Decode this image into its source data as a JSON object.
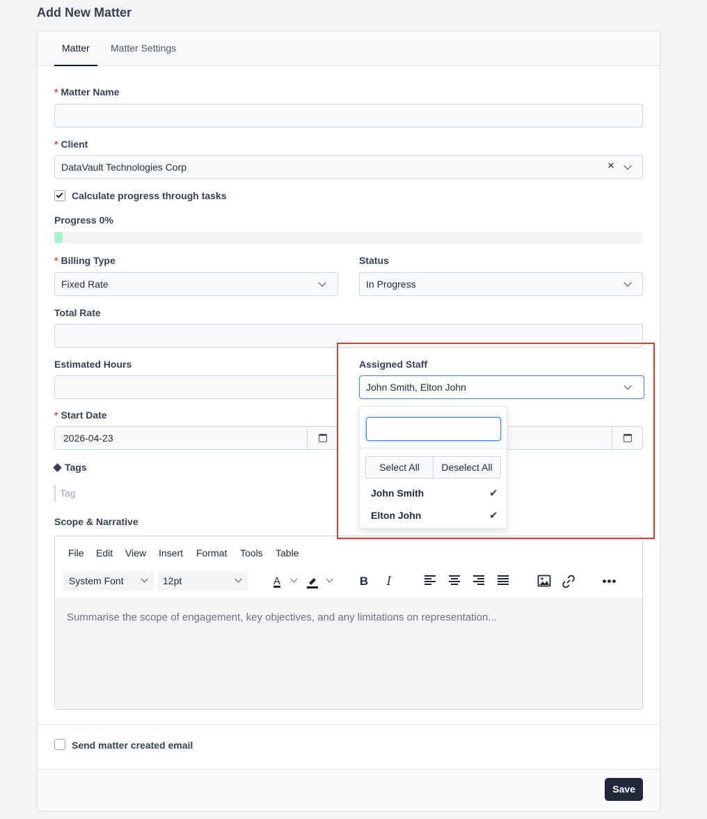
{
  "page": {
    "title": "Add New Matter"
  },
  "tabs": [
    {
      "label": "Matter"
    },
    {
      "label": "Matter Settings"
    }
  ],
  "form": {
    "required_marker": "*",
    "matter_name": {
      "label": "Matter Name",
      "value": ""
    },
    "client": {
      "label": "Client",
      "value": "DataVault Technologies Corp"
    },
    "calculate_progress": {
      "label": "Calculate progress through tasks",
      "checked": true
    },
    "progress": {
      "label": "Progress 0%",
      "value": 0
    },
    "billing_type": {
      "label": "Billing Type",
      "value": "Fixed Rate"
    },
    "status": {
      "label": "Status",
      "value": "In Progress"
    },
    "total_rate": {
      "label": "Total Rate",
      "value": ""
    },
    "estimated_hours": {
      "label": "Estimated Hours",
      "value": ""
    },
    "assigned_staff": {
      "label": "Assigned Staff",
      "value": "John Smith, Elton John",
      "search_value": "",
      "select_all": "Select All",
      "deselect_all": "Deselect All",
      "options": [
        {
          "label": "John Smith",
          "selected": true
        },
        {
          "label": "Elton John",
          "selected": true
        }
      ]
    },
    "start_date": {
      "label": "Start Date",
      "value": "2026-04-23"
    },
    "tags": {
      "label": "Tags",
      "placeholder": "Tag"
    },
    "scope": {
      "label": "Scope & Narrative",
      "menu": [
        "File",
        "Edit",
        "View",
        "Insert",
        "Format",
        "Tools",
        "Table"
      ],
      "font": "System Font",
      "size": "12pt",
      "placeholder": "Summarise the scope of engagement, key objectives, and any limitations on representation..."
    },
    "send_email": {
      "label": "Send matter created email",
      "checked": false
    }
  },
  "actions": {
    "save": "Save"
  },
  "colors": {
    "highlight": "#e5392f",
    "progress": "#a7f3d0",
    "primary": "#1f2937",
    "focus": "#3b82f6"
  }
}
